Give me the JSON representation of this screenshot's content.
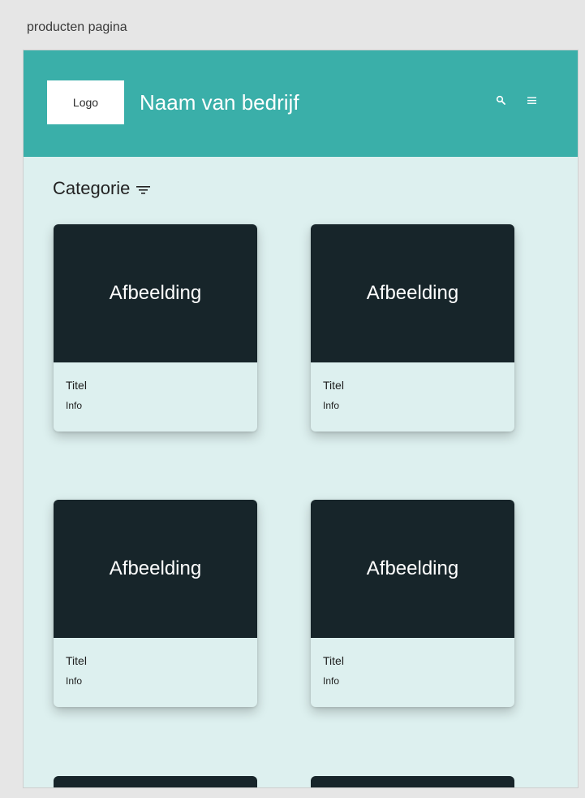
{
  "artboard": {
    "label": "producten pagina"
  },
  "header": {
    "logo_text": "Logo",
    "company_name": "Naam van bedrijf",
    "icons": {
      "search": "search-icon",
      "menu": "hamburger-menu-icon"
    }
  },
  "category": {
    "label": "Categorie",
    "icon": "filter-icon"
  },
  "products": [
    {
      "image_label": "Afbeelding",
      "title": "Titel",
      "info": "Info"
    },
    {
      "image_label": "Afbeelding",
      "title": "Titel",
      "info": "Info"
    },
    {
      "image_label": "Afbeelding",
      "title": "Titel",
      "info": "Info"
    },
    {
      "image_label": "Afbeelding",
      "title": "Titel",
      "info": "Info"
    }
  ],
  "colors": {
    "header": "#3aafa9",
    "page_background": "#ddf0ef",
    "image_placeholder": "#17252a",
    "canvas": "#e6e6e6"
  }
}
